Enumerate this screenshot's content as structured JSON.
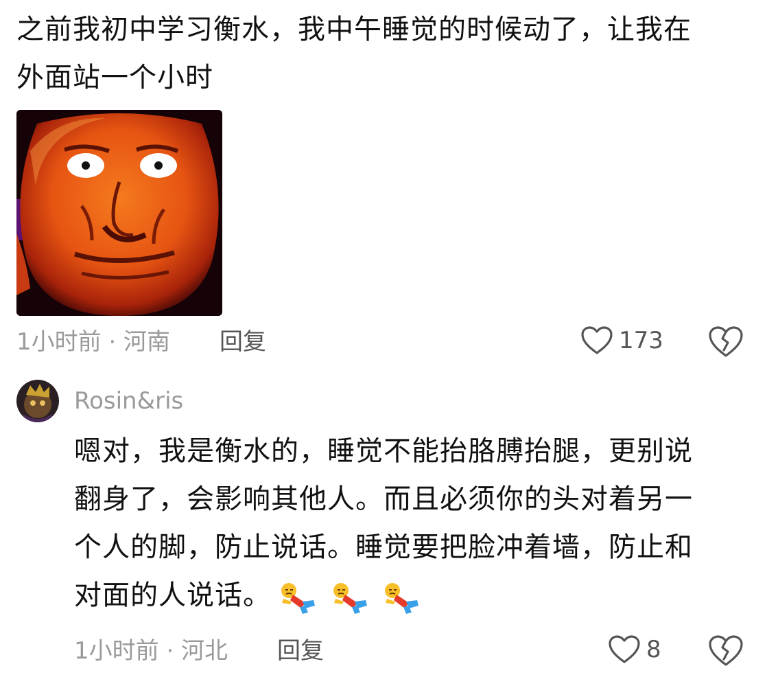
{
  "comment1": {
    "text_line1": "之前我初中学习衡水，我中午睡觉的时候动了，让我在",
    "text_line2": "外面站一个小时",
    "image_icon": "orange-face-meme",
    "meta": "1小时前 · 河南",
    "reply_label": "回复",
    "like_count": "173"
  },
  "comment2": {
    "username": "Rosin&ris",
    "text_line1": "嗯对，我是衡水的，睡觉不能抬胳膊抬腿，更别说",
    "text_line2": "翻身了，会影响其他人。而且必须你的头对着另一",
    "text_line3": "个人的脚，防止说话。睡觉要把脸冲着墙，防止和",
    "text_line4": "对面的人说话。",
    "emoji_icon": "lying-down-emoji",
    "meta": "1小时前 · 河北",
    "reply_label": "回复",
    "like_count": "8"
  },
  "icons": {
    "like": "heart-outline-icon",
    "dislike": "broken-heart-icon"
  },
  "colors": {
    "text": "#111111",
    "meta": "#9a9a9a",
    "action": "#555555"
  }
}
